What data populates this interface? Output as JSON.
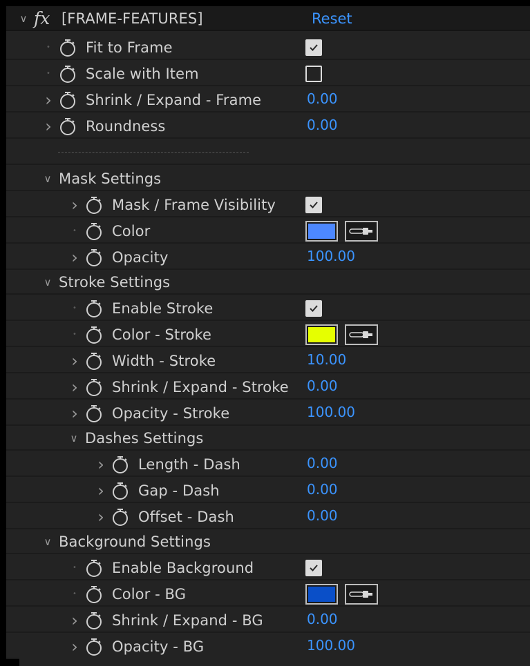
{
  "effect": {
    "name": "[FRAME-FEATURES]",
    "reset_label": "Reset",
    "fx_label": "fx"
  },
  "rows": [
    {
      "kind": "checkbox",
      "depth": 1,
      "twirl": "dot",
      "label": "Fit to Frame",
      "checked": true
    },
    {
      "kind": "checkbox",
      "depth": 1,
      "twirl": "dot",
      "label": "Scale with Item",
      "checked": false
    },
    {
      "kind": "value",
      "depth": 1,
      "twirl": "closed",
      "label": "Shrink / Expand - Frame",
      "value": "0.00"
    },
    {
      "kind": "value",
      "depth": 1,
      "twirl": "closed",
      "label": "Roundness",
      "value": "0.00"
    },
    {
      "kind": "separator",
      "depth": 1,
      "label": "-------------------------------"
    },
    {
      "kind": "group",
      "depth": 1,
      "label": "Mask Settings"
    },
    {
      "kind": "checkbox",
      "depth": 2,
      "twirl": "closed",
      "label": "Mask / Frame Visibility",
      "checked": true
    },
    {
      "kind": "color",
      "depth": 2,
      "twirl": "dot",
      "label": "Color",
      "color": "#4d88ff"
    },
    {
      "kind": "value",
      "depth": 2,
      "twirl": "closed",
      "label": "Opacity",
      "value": "100.00"
    },
    {
      "kind": "group",
      "depth": 1,
      "label": "Stroke Settings"
    },
    {
      "kind": "checkbox",
      "depth": 2,
      "twirl": "dot",
      "label": "Enable Stroke",
      "checked": true
    },
    {
      "kind": "color",
      "depth": 2,
      "twirl": "dot",
      "label": "Color - Stroke",
      "color": "#e6ff00"
    },
    {
      "kind": "value",
      "depth": 2,
      "twirl": "closed",
      "label": "Width - Stroke",
      "value": "10.00"
    },
    {
      "kind": "value",
      "depth": 2,
      "twirl": "closed",
      "label": "Shrink / Expand - Stroke",
      "value": "0.00"
    },
    {
      "kind": "value",
      "depth": 2,
      "twirl": "closed",
      "label": "Opacity - Stroke",
      "value": "100.00"
    },
    {
      "kind": "group",
      "depth": 2,
      "label": "Dashes Settings"
    },
    {
      "kind": "value",
      "depth": 3,
      "twirl": "closed",
      "label": "Length - Dash",
      "value": "0.00"
    },
    {
      "kind": "value",
      "depth": 3,
      "twirl": "closed",
      "label": "Gap - Dash",
      "value": "0.00"
    },
    {
      "kind": "value",
      "depth": 3,
      "twirl": "closed",
      "label": "Offset - Dash",
      "value": "0.00"
    },
    {
      "kind": "group",
      "depth": 1,
      "label": "Background Settings"
    },
    {
      "kind": "checkbox",
      "depth": 2,
      "twirl": "dot",
      "label": "Enable Background",
      "checked": true
    },
    {
      "kind": "color",
      "depth": 2,
      "twirl": "dot",
      "label": "Color - BG",
      "color": "#0a4fc8"
    },
    {
      "kind": "value",
      "depth": 2,
      "twirl": "closed",
      "label": "Shrink / Expand - BG",
      "value": "0.00"
    },
    {
      "kind": "value",
      "depth": 2,
      "twirl": "closed",
      "label": "Opacity - BG",
      "value": "100.00"
    }
  ],
  "icons": {
    "stopwatch": "stopwatch-icon",
    "twirl_open": "chevron-down-icon",
    "twirl_closed": "chevron-right-icon",
    "eyedropper": "eyedropper-icon"
  }
}
